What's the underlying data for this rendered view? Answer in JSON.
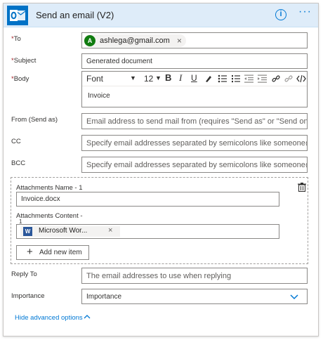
{
  "header": {
    "title": "Send an email (V2)",
    "info_glyph": "i",
    "more_glyph": "···"
  },
  "to": {
    "label": "To",
    "required_mark": "*",
    "recipient": {
      "initial": "A",
      "email": "ashlega@gmail.com",
      "remove": "×",
      "avatar_color": "#107c10"
    }
  },
  "subject": {
    "label": "Subject",
    "required_mark": "*",
    "value": "Generated document"
  },
  "body": {
    "label": "Body",
    "required_mark": "*",
    "value": "Invoice",
    "toolbar": {
      "font": "Font",
      "font_chevron": "▼",
      "size": "12",
      "size_chevron": "▼",
      "bold": "B",
      "italic": "I",
      "underline": "U"
    }
  },
  "from": {
    "label": "From (Send as)",
    "placeholder": "Email address to send mail from (requires \"Send as\" or \"Send on beh"
  },
  "cc": {
    "label": "CC",
    "placeholder": "Specify email addresses separated by semicolons like someone@con"
  },
  "bcc": {
    "label": "BCC",
    "placeholder": "Specify email addresses separated by semicolons like someone@con"
  },
  "attachments": {
    "name_label": "Attachments Name - 1",
    "name_value": "Invoice.docx",
    "content_label": "Attachments Content -",
    "content_label_suffix": "1",
    "content_chip": {
      "icon_letter": "W",
      "text": "Microsoft Wor...",
      "remove": "×"
    },
    "add_button": "Add new item",
    "add_glyph": "+"
  },
  "reply_to": {
    "label": "Reply To",
    "placeholder": "The email addresses to use when replying"
  },
  "importance": {
    "label": "Importance",
    "value": "Importance"
  },
  "footer": {
    "hide_advanced": "Hide advanced options",
    "chevron": "⌃"
  },
  "colors": {
    "accent": "#0078d4",
    "header_bg": "#deecf9",
    "required": "#a4262c",
    "outlook_blue": "#0072c6",
    "word_blue": "#2b579a"
  },
  "icons": [
    "outlook-icon",
    "info-icon",
    "more-icon",
    "bold-icon",
    "italic-icon",
    "underline-icon",
    "color-icon",
    "bullet-list-icon",
    "numbered-list-icon",
    "outdent-icon",
    "indent-icon",
    "link-icon",
    "unlink-icon",
    "code-icon",
    "delete-icon",
    "word-icon",
    "chevron-down-icon",
    "chevron-up-icon"
  ]
}
